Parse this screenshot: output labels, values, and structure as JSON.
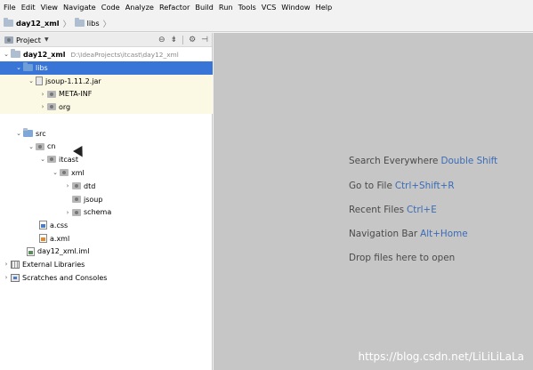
{
  "menubar": {
    "items": [
      {
        "label": "File"
      },
      {
        "label": "Edit"
      },
      {
        "label": "View"
      },
      {
        "label": "Navigate"
      },
      {
        "label": "Code"
      },
      {
        "label": "Analyze"
      },
      {
        "label": "Refactor"
      },
      {
        "label": "Build"
      },
      {
        "label": "Run"
      },
      {
        "label": "Tools"
      },
      {
        "label": "VCS"
      },
      {
        "label": "Window"
      },
      {
        "label": "Help"
      }
    ]
  },
  "breadcrumb": {
    "project": "day12_xml",
    "folder": "libs"
  },
  "panel": {
    "title": "Project",
    "tools": {
      "target": "⊖",
      "collapse": "⇟",
      "settings": "⚙",
      "hide": "⊣"
    }
  },
  "tree": {
    "root": {
      "label": "day12_xml",
      "path": "D:\\IdeaProjects\\itcast\\day12_xml"
    },
    "libs": "libs",
    "jar": "jsoup-1.11.2.jar",
    "meta_inf": "META-INF",
    "org": "org",
    "src": "src",
    "cn": "cn",
    "itcast": "itcast",
    "xml": "xml",
    "dtd": "dtd",
    "jsoup": "jsoup",
    "schema": "schema",
    "a_css": "a.css",
    "a_xml": "a.xml",
    "iml": "day12_xml.iml",
    "external_libraries": "External Libraries",
    "scratches": "Scratches and Consoles"
  },
  "editor": {
    "hints": [
      {
        "text": "Search Everywhere",
        "shortcut": "Double Shift"
      },
      {
        "text": "Go to File",
        "shortcut": "Ctrl+Shift+R"
      },
      {
        "text": "Recent Files",
        "shortcut": "Ctrl+E"
      },
      {
        "text": "Navigation Bar",
        "shortcut": "Alt+Home"
      },
      {
        "text": "Drop files here to open",
        "shortcut": ""
      }
    ],
    "watermark": "https://blog.csdn.net/LiLiLiLaLa"
  },
  "colors": {
    "selection": "#3875d7",
    "editor_bg": "#c6c6c6",
    "shortcut": "#3b6bb5",
    "highlight_row": "#fbf8e3"
  }
}
